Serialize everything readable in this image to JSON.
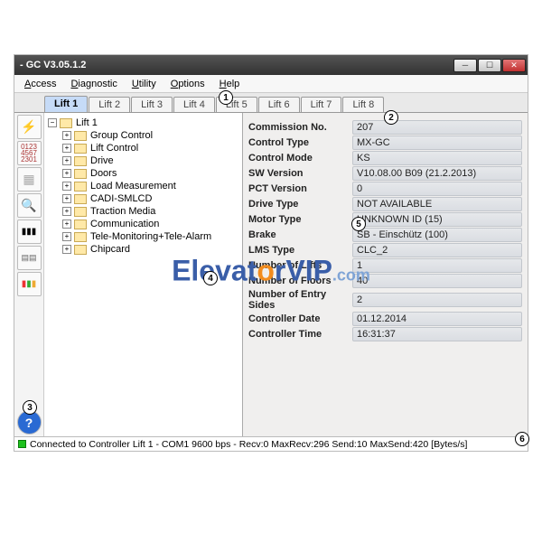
{
  "window": {
    "title": " - GC V3.05.1.2"
  },
  "menu": {
    "access": "Access",
    "diagnostic": "Diagnostic",
    "utility": "Utility",
    "options": "Options",
    "help": "Help"
  },
  "tabs": [
    "Lift 1",
    "Lift 2",
    "Lift 3",
    "Lift 4",
    "Lift 5",
    "Lift 6",
    "Lift 7",
    "Lift 8"
  ],
  "tree": {
    "root": "Lift 1",
    "items": [
      "Group Control",
      "Lift Control",
      "Drive",
      "Doors",
      "Load Measurement",
      "CADI-SMLCD",
      "Traction Media",
      "Communication",
      "Tele-Monitoring+Tele-Alarm",
      "Chipcard"
    ]
  },
  "details": {
    "commission_no": {
      "label": "Commission No.",
      "value": "207"
    },
    "control_type": {
      "label": "Control Type",
      "value": "MX-GC"
    },
    "control_mode": {
      "label": "Control Mode",
      "value": "KS"
    },
    "sw_version": {
      "label": "SW Version",
      "value": "V10.08.00 B09 (21.2.2013)"
    },
    "pct_version": {
      "label": "PCT Version",
      "value": "0"
    },
    "drive_type": {
      "label": "Drive Type",
      "value": "NOT AVAILABLE"
    },
    "motor_type": {
      "label": "Motor Type",
      "value": "UNKNOWN ID (15)"
    },
    "brake": {
      "label": "Brake",
      "value": "SB - Einschütz (100)"
    },
    "lms_type": {
      "label": "LMS Type",
      "value": "CLC_2"
    },
    "number_lifts": {
      "label": "Number of Lifts",
      "value": "1"
    },
    "number_floors": {
      "label": "Number of Floors",
      "value": "40"
    },
    "number_entry": {
      "label": "Number of Entry Sides",
      "value": "2"
    },
    "controller_date": {
      "label": "Controller Date",
      "value": "01.12.2014"
    },
    "controller_time": {
      "label": "Controller Time",
      "value": "16:31:37"
    }
  },
  "status": "Connected to Controller Lift 1 - COM1 9600 bps - Recv:0   MaxRecv:296 Send:10  MaxSend:420 [Bytes/s]",
  "callouts": {
    "c1": "1",
    "c2": "2",
    "c3": "3",
    "c4": "4",
    "c5": "5",
    "c6": "6"
  },
  "watermark": {
    "a": "Elevat",
    "b": "o",
    "c": "rVIP",
    "d": ".com"
  }
}
